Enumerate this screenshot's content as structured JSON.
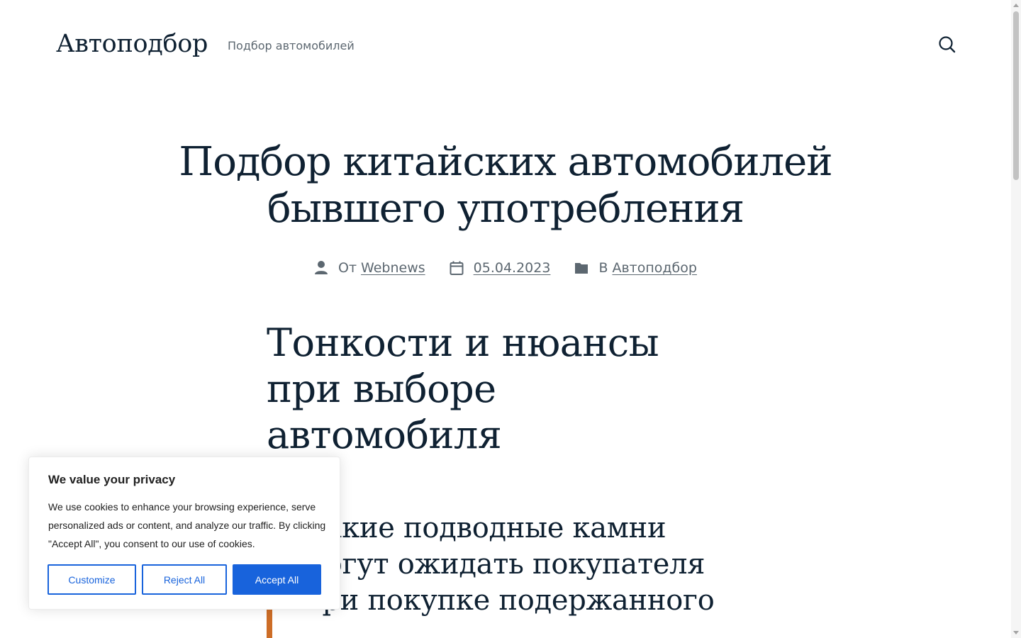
{
  "header": {
    "site_title": "Автоподбор",
    "tagline": "Подбор автомобилей",
    "search_icon": "search-icon"
  },
  "post": {
    "title": "Подбор китайских автомобилей бывшего употребления",
    "meta": {
      "author_prefix": "От",
      "author": "Webnews",
      "date": "05.04.2023",
      "category_prefix": "В",
      "category": "Автоподбор",
      "icons": [
        "person-icon",
        "calendar-icon",
        "folder-icon"
      ]
    },
    "heading_2": "Тонкости и нюансы при выборе автомобиля",
    "heading_3": "Какие подводные камни могут ожидать покупателя при покупке подержанного"
  },
  "cookie_banner": {
    "title": "We value your privacy",
    "text": "We use cookies to enhance your browsing experience, serve personalized ads or content, and analyze our traffic. By clicking \"Accept All\", you consent to our use of cookies.",
    "customize_label": "Customize",
    "reject_label": "Reject All",
    "accept_label": "Accept All",
    "accent_color": "#1863dc"
  },
  "colors": {
    "text": "#0f2132",
    "muted": "#5c6770",
    "quote_accent": "#cd6d27"
  }
}
